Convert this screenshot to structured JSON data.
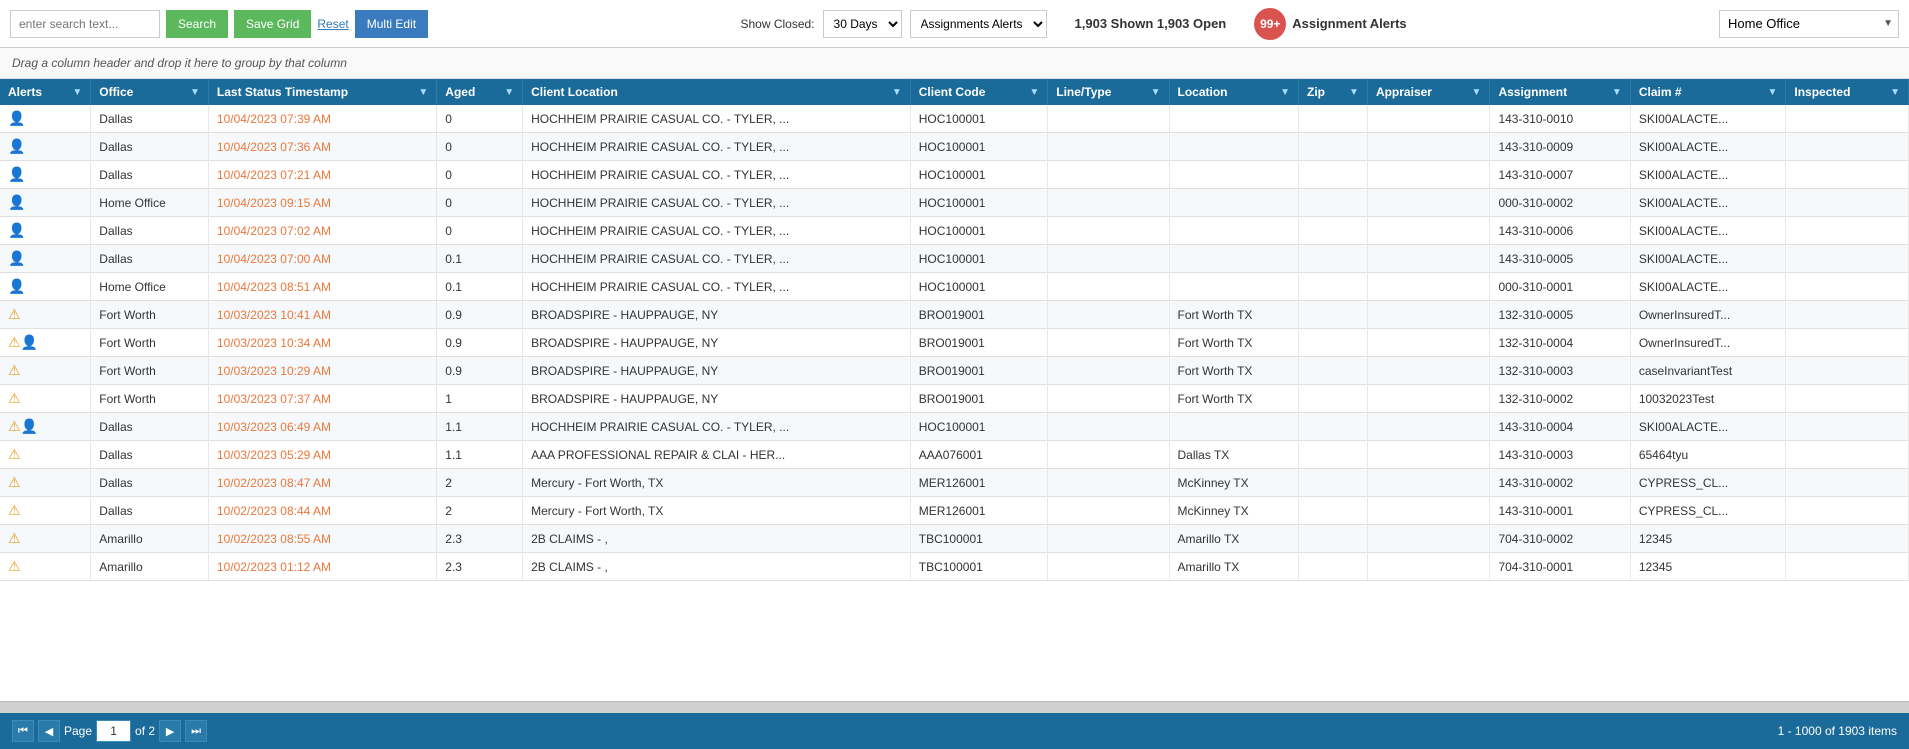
{
  "toolbar": {
    "search_placeholder": "enter search text...",
    "search_label": "Search",
    "save_grid_label": "Save Grid",
    "reset_label": "Reset",
    "multi_edit_label": "Multi Edit",
    "show_closed_label": "Show Closed:",
    "show_closed_value": "30 Days",
    "dropdown_value": "Assignments Alerts",
    "shown_count": "1,903 Shown  1,903 Open",
    "alert_badge": "99+",
    "assignment_alerts_label": "Assignment Alerts",
    "home_office_value": "Home Office"
  },
  "drag_hint": "Drag a column header and drop it here to group by that column",
  "columns": [
    {
      "key": "alerts",
      "label": "Alerts"
    },
    {
      "key": "office",
      "label": "Office"
    },
    {
      "key": "last_status_timestamp",
      "label": "Last Status Timestamp"
    },
    {
      "key": "aged",
      "label": "Aged"
    },
    {
      "key": "client_location",
      "label": "Client Location"
    },
    {
      "key": "client_code",
      "label": "Client Code"
    },
    {
      "key": "line_type",
      "label": "Line/Type"
    },
    {
      "key": "location",
      "label": "Location"
    },
    {
      "key": "zip",
      "label": "Zip"
    },
    {
      "key": "appraiser",
      "label": "Appraiser"
    },
    {
      "key": "assignment",
      "label": "Assignment"
    },
    {
      "key": "claim_num",
      "label": "Claim #"
    },
    {
      "key": "inspected",
      "label": "Inspected"
    }
  ],
  "rows": [
    {
      "alerts": "user",
      "office": "Dallas",
      "timestamp": "10/04/2023 07:39 AM",
      "aged": "0",
      "client_location": "HOCHHEIM PRAIRIE CASUAL CO. - TYLER, ...",
      "client_code": "HOC100001",
      "line_type": "",
      "location": "",
      "zip": "",
      "appraiser": "",
      "assignment": "143-310-0010",
      "claim_num": "SKI00ALACTE...",
      "inspected": ""
    },
    {
      "alerts": "user",
      "office": "Dallas",
      "timestamp": "10/04/2023 07:36 AM",
      "aged": "0",
      "client_location": "HOCHHEIM PRAIRIE CASUAL CO. - TYLER, ...",
      "client_code": "HOC100001",
      "line_type": "",
      "location": "",
      "zip": "",
      "appraiser": "",
      "assignment": "143-310-0009",
      "claim_num": "SKI00ALACTE...",
      "inspected": ""
    },
    {
      "alerts": "user",
      "office": "Dallas",
      "timestamp": "10/04/2023 07:21 AM",
      "aged": "0",
      "client_location": "HOCHHEIM PRAIRIE CASUAL CO. - TYLER, ...",
      "client_code": "HOC100001",
      "line_type": "",
      "location": "",
      "zip": "",
      "appraiser": "",
      "assignment": "143-310-0007",
      "claim_num": "SKI00ALACTE...",
      "inspected": ""
    },
    {
      "alerts": "user",
      "office": "Home Office",
      "timestamp": "10/04/2023 09:15 AM",
      "aged": "0",
      "client_location": "HOCHHEIM PRAIRIE CASUAL CO. - TYLER, ...",
      "client_code": "HOC100001",
      "line_type": "",
      "location": "",
      "zip": "",
      "appraiser": "",
      "assignment": "000-310-0002",
      "claim_num": "SKI00ALACTE...",
      "inspected": ""
    },
    {
      "alerts": "user",
      "office": "Dallas",
      "timestamp": "10/04/2023 07:02 AM",
      "aged": "0",
      "client_location": "HOCHHEIM PRAIRIE CASUAL CO. - TYLER, ...",
      "client_code": "HOC100001",
      "line_type": "",
      "location": "",
      "zip": "",
      "appraiser": "",
      "assignment": "143-310-0006",
      "claim_num": "SKI00ALACTE...",
      "inspected": ""
    },
    {
      "alerts": "user",
      "office": "Dallas",
      "timestamp": "10/04/2023 07:00 AM",
      "aged": "0.1",
      "client_location": "HOCHHEIM PRAIRIE CASUAL CO. - TYLER, ...",
      "client_code": "HOC100001",
      "line_type": "",
      "location": "",
      "zip": "",
      "appraiser": "",
      "assignment": "143-310-0005",
      "claim_num": "SKI00ALACTE...",
      "inspected": ""
    },
    {
      "alerts": "user",
      "office": "Home Office",
      "timestamp": "10/04/2023 08:51 AM",
      "aged": "0.1",
      "client_location": "HOCHHEIM PRAIRIE CASUAL CO. - TYLER, ...",
      "client_code": "HOC100001",
      "line_type": "",
      "location": "",
      "zip": "",
      "appraiser": "",
      "assignment": "000-310-0001",
      "claim_num": "SKI00ALACTE...",
      "inspected": ""
    },
    {
      "alerts": "warn",
      "office": "Fort Worth",
      "timestamp": "10/03/2023 10:41 AM",
      "aged": "0.9",
      "client_location": "BROADSPIRE - HAUPPAUGE, NY",
      "client_code": "BRO019001",
      "line_type": "",
      "location": "Fort Worth TX",
      "zip": "",
      "appraiser": "",
      "assignment": "132-310-0005",
      "claim_num": "OwnerInsuredT...",
      "inspected": ""
    },
    {
      "alerts": "both",
      "office": "Fort Worth",
      "timestamp": "10/03/2023 10:34 AM",
      "aged": "0.9",
      "client_location": "BROADSPIRE - HAUPPAUGE, NY",
      "client_code": "BRO019001",
      "line_type": "",
      "location": "Fort Worth TX",
      "zip": "",
      "appraiser": "",
      "assignment": "132-310-0004",
      "claim_num": "OwnerInsuredT...",
      "inspected": ""
    },
    {
      "alerts": "warn",
      "office": "Fort Worth",
      "timestamp": "10/03/2023 10:29 AM",
      "aged": "0.9",
      "client_location": "BROADSPIRE - HAUPPAUGE, NY",
      "client_code": "BRO019001",
      "line_type": "",
      "location": "Fort Worth TX",
      "zip": "",
      "appraiser": "",
      "assignment": "132-310-0003",
      "claim_num": "caseInvariantTest",
      "inspected": ""
    },
    {
      "alerts": "warn",
      "office": "Fort Worth",
      "timestamp": "10/03/2023 07:37 AM",
      "aged": "1",
      "client_location": "BROADSPIRE - HAUPPAUGE, NY",
      "client_code": "BRO019001",
      "line_type": "",
      "location": "Fort Worth TX",
      "zip": "",
      "appraiser": "",
      "assignment": "132-310-0002",
      "claim_num": "10032023Test",
      "inspected": ""
    },
    {
      "alerts": "both",
      "office": "Dallas",
      "timestamp": "10/03/2023 06:49 AM",
      "aged": "1.1",
      "client_location": "HOCHHEIM PRAIRIE CASUAL CO. - TYLER, ...",
      "client_code": "HOC100001",
      "line_type": "",
      "location": "",
      "zip": "",
      "appraiser": "",
      "assignment": "143-310-0004",
      "claim_num": "SKI00ALACTE...",
      "inspected": ""
    },
    {
      "alerts": "warn",
      "office": "Dallas",
      "timestamp": "10/03/2023 05:29 AM",
      "aged": "1.1",
      "client_location": "AAA PROFESSIONAL REPAIR & CLAI - HER...",
      "client_code": "AAA076001",
      "line_type": "",
      "location": "Dallas TX",
      "zip": "",
      "appraiser": "",
      "assignment": "143-310-0003",
      "claim_num": "65464tyu",
      "inspected": ""
    },
    {
      "alerts": "warn",
      "office": "Dallas",
      "timestamp": "10/02/2023 08:47 AM",
      "aged": "2",
      "client_location": "Mercury - Fort Worth, TX",
      "client_code": "MER126001",
      "line_type": "",
      "location": "McKinney TX",
      "zip": "",
      "appraiser": "",
      "assignment": "143-310-0002",
      "claim_num": "CYPRESS_CL...",
      "inspected": ""
    },
    {
      "alerts": "warn",
      "office": "Dallas",
      "timestamp": "10/02/2023 08:44 AM",
      "aged": "2",
      "client_location": "Mercury - Fort Worth, TX",
      "client_code": "MER126001",
      "line_type": "",
      "location": "McKinney TX",
      "zip": "",
      "appraiser": "",
      "assignment": "143-310-0001",
      "claim_num": "CYPRESS_CL...",
      "inspected": ""
    },
    {
      "alerts": "warn",
      "office": "Amarillo",
      "timestamp": "10/02/2023 08:55 AM",
      "aged": "2.3",
      "client_location": "2B CLAIMS - ,",
      "client_code": "TBC100001",
      "line_type": "",
      "location": "Amarillo TX",
      "zip": "",
      "appraiser": "",
      "assignment": "704-310-0002",
      "claim_num": "12345",
      "inspected": ""
    },
    {
      "alerts": "warn",
      "office": "Amarillo",
      "timestamp": "10/02/2023 01:12 AM",
      "aged": "2.3",
      "client_location": "2B CLAIMS - ,",
      "client_code": "TBC100001",
      "line_type": "",
      "location": "Amarillo TX",
      "zip": "",
      "appraiser": "",
      "assignment": "704-310-0001",
      "claim_num": "12345",
      "inspected": ""
    }
  ],
  "footer": {
    "page_label": "Page",
    "page_current": "1",
    "page_of": "of 2",
    "items_count": "1 - 1000 of 1903 items"
  }
}
